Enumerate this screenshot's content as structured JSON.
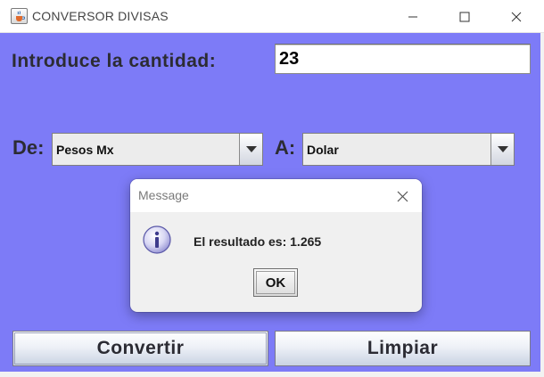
{
  "window": {
    "title": "CONVERSOR DIVISAS",
    "icon": "java-cup-icon",
    "controls": [
      "minimize-icon",
      "maximize-icon",
      "close-icon"
    ]
  },
  "form": {
    "amount_label": "Introduce la cantidad:",
    "amount_value": "23",
    "from_label": "De:",
    "from_value": "Pesos Mx",
    "to_label": "A:",
    "to_value": "Dolar",
    "convert_label": "Convertir",
    "clear_label": "Limpiar"
  },
  "dialog": {
    "title": "Message",
    "icon": "info-icon",
    "message": "El resultado es: 1.265",
    "ok_label": "OK"
  },
  "colors": {
    "panel_background": "#7d7bf7",
    "dialog_background": "#f0f0f0"
  }
}
